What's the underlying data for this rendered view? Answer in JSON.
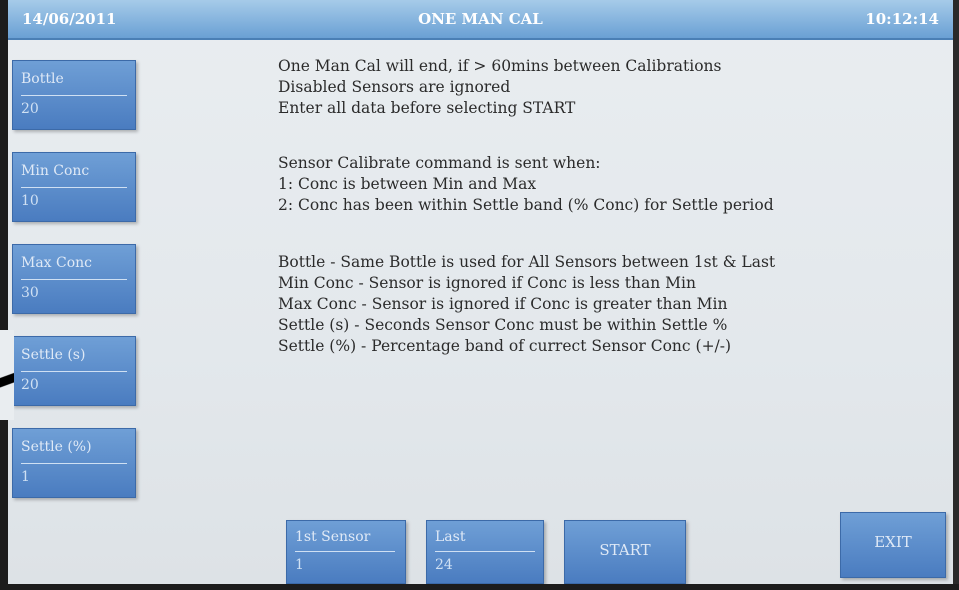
{
  "header": {
    "date": "14/06/2011",
    "title": "ONE MAN CAL",
    "time": "10:12:14"
  },
  "params": [
    {
      "label": "Bottle",
      "value": "20"
    },
    {
      "label": "Min Conc",
      "value": "10"
    },
    {
      "label": "Max Conc",
      "value": "30"
    },
    {
      "label": "Settle (s)",
      "value": "20"
    },
    {
      "label": "Settle (%)",
      "value": "1"
    }
  ],
  "info": {
    "block1": [
      "One Man Cal will end, if > 60mins between Calibrations",
      "Disabled Sensors are ignored",
      "Enter all data before selecting START"
    ],
    "block2": [
      "Sensor Calibrate command is sent when:",
      "1: Conc is between Min and Max",
      "2: Conc has been within Settle band (% Conc) for Settle period"
    ],
    "block3": [
      "Bottle - Same Bottle is used for All Sensors between 1st & Last",
      "Min Conc - Sensor is ignored if Conc is less than Min",
      "Max Conc - Sensor is ignored if Conc is greater than Min",
      "Settle (s) - Seconds Sensor Conc must be within Settle %",
      "Settle (%) - Percentage band of currect Sensor Conc (+/-)"
    ]
  },
  "bottom": {
    "first_sensor": {
      "label": "1st Sensor",
      "value": "1"
    },
    "last_sensor": {
      "label": "Last",
      "value": "24"
    },
    "start_label": "START",
    "exit_label": "EXIT"
  },
  "colors": {
    "header": "#6aa0d4",
    "button": "#4a7cc0",
    "screen_bg": "#e6eaee",
    "text": "#2b2b2b"
  }
}
